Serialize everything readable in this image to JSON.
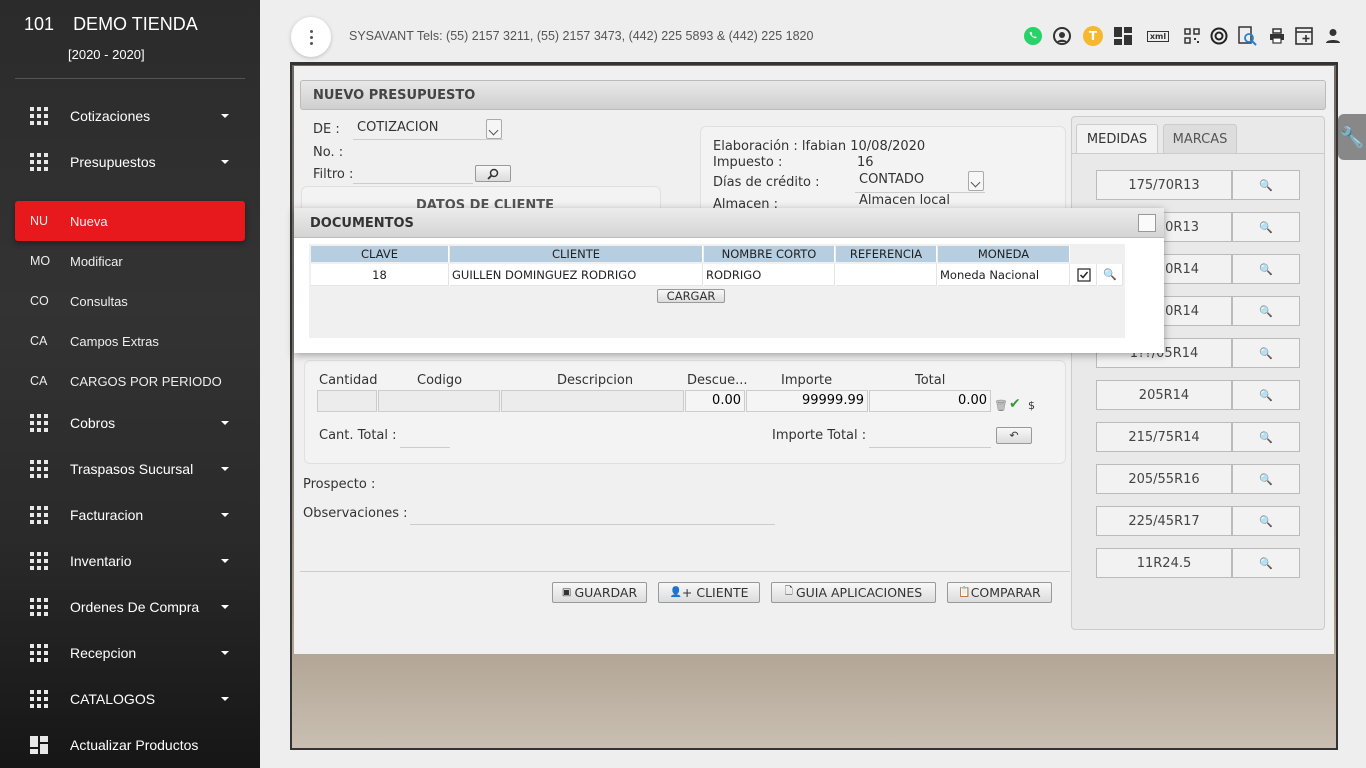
{
  "brand": {
    "number": "101",
    "name": "DEMO TIENDA",
    "years": "[2020 - 2020]"
  },
  "sidebar": {
    "items": [
      {
        "label": "Cotizaciones"
      },
      {
        "label": "Presupuestos"
      },
      {
        "label": "Cobros"
      },
      {
        "label": "Traspasos Sucursal"
      },
      {
        "label": "Facturacion"
      },
      {
        "label": "Inventario"
      },
      {
        "label": "Ordenes De Compra"
      },
      {
        "label": "Recepcion"
      },
      {
        "label": "CATALOGOS"
      },
      {
        "label": "Actualizar Productos"
      }
    ],
    "subitems": [
      {
        "abbr": "NU",
        "label": "Nueva"
      },
      {
        "abbr": "MO",
        "label": "Modificar"
      },
      {
        "abbr": "CO",
        "label": "Consultas"
      },
      {
        "abbr": "CA",
        "label": "Campos Extras"
      },
      {
        "abbr": "CA",
        "label": "CARGOS POR PERIODO"
      }
    ]
  },
  "topbar": {
    "contact": "SYSAVANT Tels: (55) 2157 3211, (55) 2157 3473, (442) 225 5893 & (442) 225 1820",
    "icons": [
      "whatsapp-icon",
      "support-icon",
      "user-initial-icon",
      "dashboard-icon",
      "xml-icon",
      "qr-icon",
      "target-icon",
      "document-search-icon",
      "printer-icon",
      "new-window-icon",
      "person-icon"
    ],
    "initial": "T",
    "xml_label": "xml"
  },
  "form": {
    "title": "NUEVO PRESUPUESTO",
    "de_label": "DE :",
    "de_value": "COTIZACION",
    "no_label": "No. :",
    "filtro_label": "Filtro :",
    "datos_cliente": "DATOS DE CLIENTE",
    "elaboracion": "Elaboración : lfabian 10/08/2020",
    "impuesto_label": "Impuesto :",
    "impuesto_value": "16",
    "dias_label": "Días de crédito :",
    "dias_value": "CONTADO",
    "almacen_label": "Almacen :",
    "almacen_value": "Almacen local"
  },
  "items_table": {
    "headers": [
      "Cantidad",
      "Codigo",
      "Descripcion",
      "Descue...",
      "Importe",
      "Total"
    ],
    "descuento": "0.00",
    "importe": "99999.99",
    "total": "0.00",
    "currency": "$",
    "cant_total_label": "Cant. Total :",
    "importe_total_label": "Importe Total :"
  },
  "prospecto_label": "Prospecto :",
  "observaciones_label": "Observaciones :",
  "actions": {
    "guardar": "GUARDAR",
    "cliente": "+ CLIENTE",
    "guia": "GUIA APLICACIONES",
    "comparar": "COMPARAR"
  },
  "medidas": {
    "tabs": [
      "MEDIDAS",
      "MARCAS"
    ],
    "sizes": [
      "175/70R13",
      "0R13",
      "0R14",
      "0R14",
      "1??/05R14",
      "205R14",
      "215/75R14",
      "205/55R16",
      "225/45R17",
      "11R24.5"
    ]
  },
  "documentos": {
    "title": "DOCUMENTOS",
    "headers": [
      "CLAVE",
      "CLIENTE",
      "NOMBRE CORTO",
      "REFERENCIA",
      "MONEDA"
    ],
    "rows": [
      {
        "clave": "18",
        "cliente": "GUILLEN DOMINGUEZ RODRIGO",
        "nombre_corto": "RODRIGO",
        "referencia": "",
        "moneda": "Moneda Nacional"
      }
    ],
    "cargar": "CARGAR"
  }
}
